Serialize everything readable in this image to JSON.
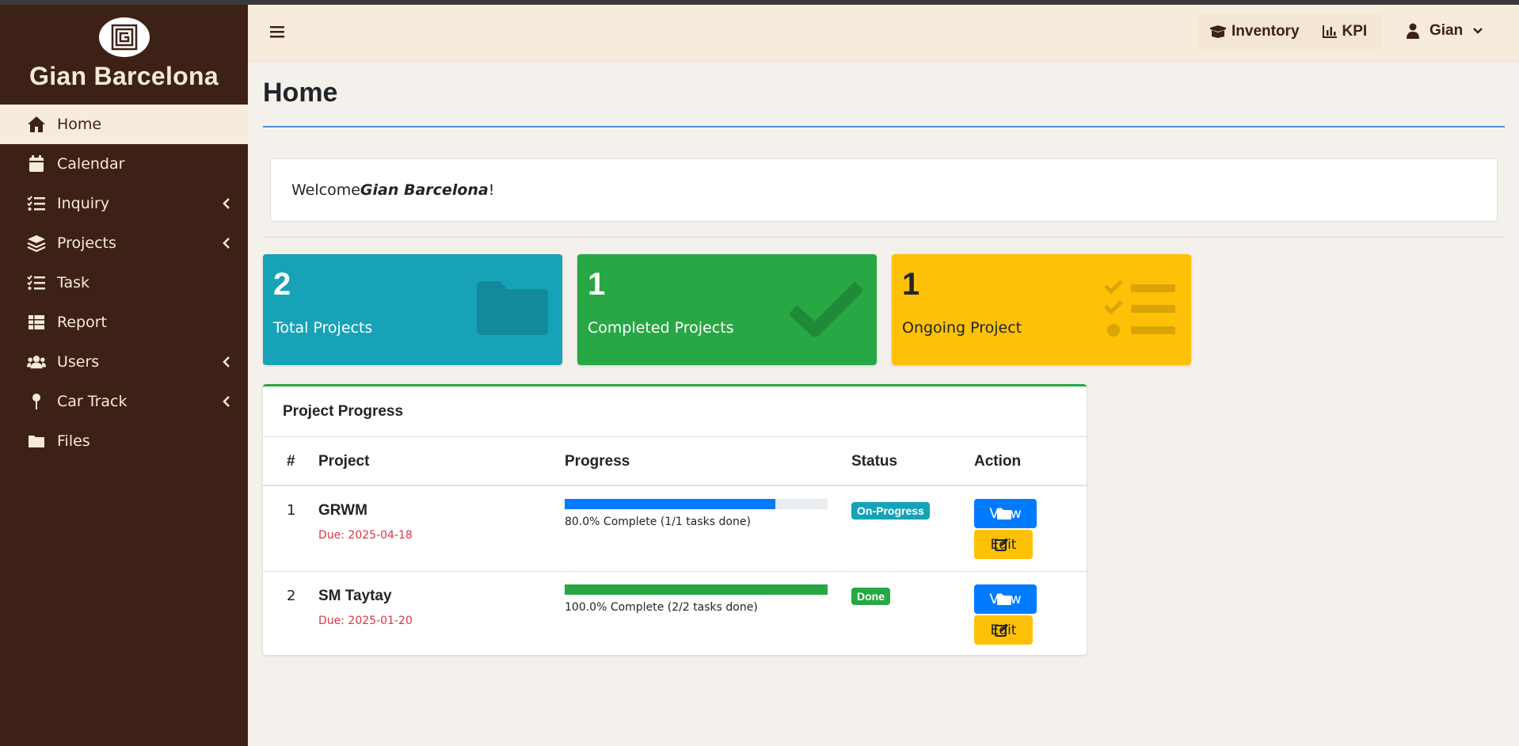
{
  "brand": {
    "name": "Gian Barcelona"
  },
  "sidebar": {
    "items": [
      {
        "label": "Home",
        "icon": "home-icon",
        "active": true
      },
      {
        "label": "Calendar",
        "icon": "calendar-icon"
      },
      {
        "label": "Inquiry",
        "icon": "list-check-icon",
        "has_submenu": true
      },
      {
        "label": "Projects",
        "icon": "layers-icon",
        "has_submenu": true
      },
      {
        "label": "Task",
        "icon": "list-check-icon"
      },
      {
        "label": "Report",
        "icon": "table-icon"
      },
      {
        "label": "Users",
        "icon": "users-icon",
        "has_submenu": true
      },
      {
        "label": "Car Track",
        "icon": "map-pin-icon",
        "has_submenu": true
      },
      {
        "label": "Files",
        "icon": "folder-icon"
      }
    ]
  },
  "topbar": {
    "inventory_label": "Inventory",
    "kpi_label": "KPI",
    "user_name": "Gian"
  },
  "main": {
    "title": "Home",
    "welcome_prefix": "Welcome ",
    "welcome_name": "Gian Barcelona",
    "welcome_suffix": "!"
  },
  "stats": [
    {
      "value": "2",
      "label": "Total Projects",
      "color": "#17a2b8"
    },
    {
      "value": "1",
      "label": "Completed Projects",
      "color": "#28a745"
    },
    {
      "value": "1",
      "label": "Ongoing Project",
      "color": "#ffc107"
    }
  ],
  "project_progress": {
    "title": "Project Progress",
    "columns": {
      "num": "#",
      "project": "Project",
      "progress": "Progress",
      "status": "Status",
      "action": "Action"
    },
    "rows": [
      {
        "num": "1",
        "project": "GRWM",
        "due": "Due: 2025-04-18",
        "progress": 0.8,
        "progress_text": "80.0% Complete (1/1 tasks done)",
        "status": "On-Progress",
        "status_color": "#17a2b8",
        "bar_color": "#007bff",
        "view_label": "View",
        "edit_label": "Edit"
      },
      {
        "num": "2",
        "project": "SM Taytay",
        "due": "Due: 2025-01-20",
        "progress": 1.0,
        "progress_text": "100.0% Complete (2/2 tasks done)",
        "status": "Done",
        "status_color": "#28a745",
        "bar_color": "#28a745",
        "view_label": "View",
        "edit_label": "Edit"
      }
    ]
  },
  "colors": {
    "sidebar_bg": "#3e2116",
    "topbar_bg": "#f7ecdc",
    "accent_rule": "#4a90d9"
  }
}
